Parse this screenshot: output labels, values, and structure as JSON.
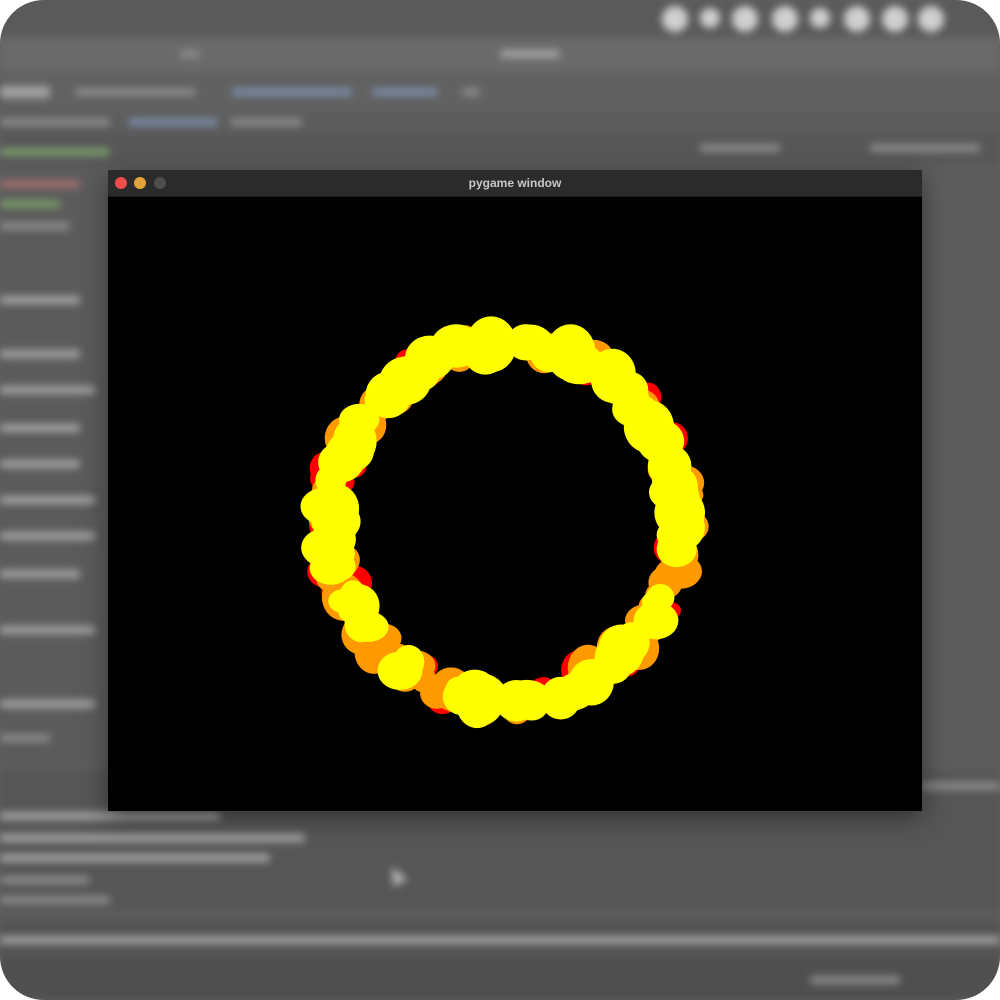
{
  "window": {
    "title": "pygame window",
    "close_color": "#ee4e4b",
    "minimize_color": "#e3a33b",
    "zoom_color": "#4d4d4d"
  },
  "canvas": {
    "background": "#000000",
    "ring_colors": [
      "#ff0000",
      "#ff9900",
      "#ffff00"
    ]
  }
}
